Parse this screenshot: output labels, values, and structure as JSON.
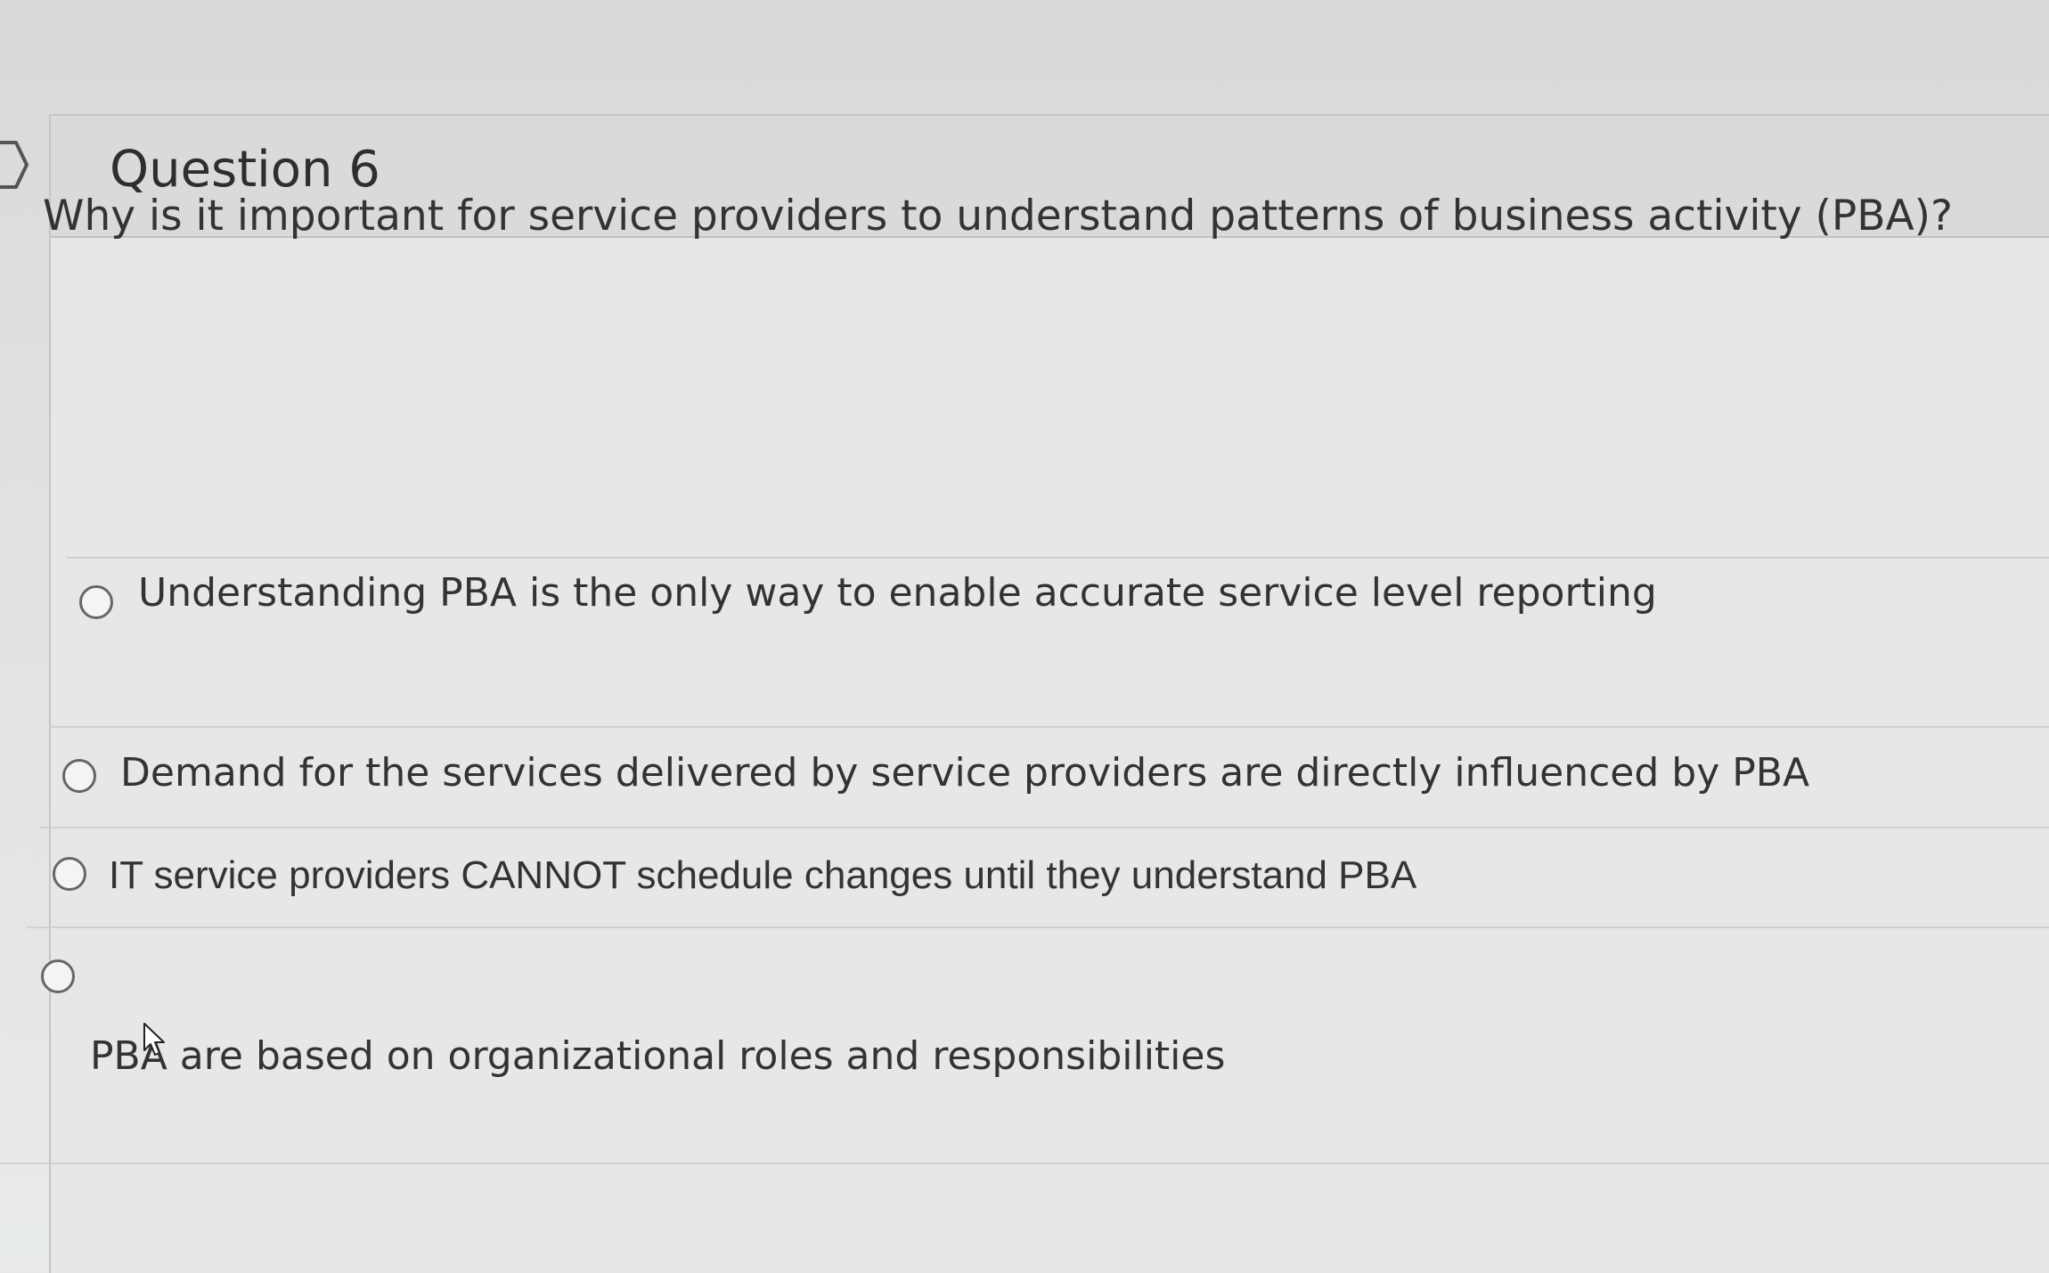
{
  "question": {
    "title": "Question 6",
    "text": "Why is it important for service providers to understand patterns of business activity (PBA)?"
  },
  "answers": [
    {
      "label": "Understanding PBA is the only way to enable accurate service level reporting",
      "selected": false
    },
    {
      "label": "Demand for the services delivered by service providers are directly influenced by PBA",
      "selected": false
    },
    {
      "label": "IT service providers CANNOT schedule changes until they understand PBA",
      "selected": false
    },
    {
      "label": "PBA are based on organizational roles and responsibilities",
      "selected": false
    }
  ],
  "icons": {
    "nav": "chevron-right-icon",
    "cursor": "mouse-pointer-icon"
  },
  "colors": {
    "background": "#e3e5e4",
    "header": "#d9dbda",
    "text": "#333333",
    "radio_border": "#666666"
  }
}
